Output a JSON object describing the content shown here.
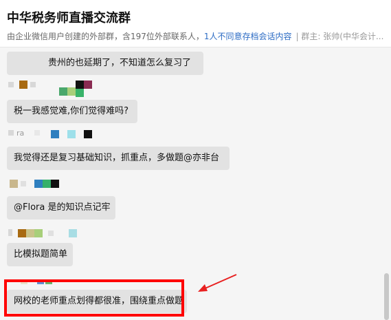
{
  "header": {
    "title": "中华税务师直播交流群",
    "subtitle_prefix": "由企业微信用户创建的外部群，含197位外部联系人，",
    "subtitle_link": "1人不同意存档会话内容",
    "subtitle_suffix": "| 群主: 张帅(中华会计..."
  },
  "messages": [
    {
      "name": "贵州的也延期了，不知道怎么复习了",
      "text": ""
    },
    {
      "name": "",
      "text": "税一我感觉难,你们觉得难吗?"
    },
    {
      "name": "ra",
      "text": "我觉得还是复习基础知识，抓重点，多做题@亦非台"
    },
    {
      "name": "",
      "text": "@Flora  是的知识点记牢"
    },
    {
      "name": "",
      "text": "比模拟题简单"
    },
    {
      "name": "",
      "text": "网校的老师重点划得都很准，围绕重点做题"
    }
  ],
  "colors": {
    "highlight": "#ff0000",
    "link": "#2d6cc4",
    "bubble": "#e2e2e2"
  }
}
